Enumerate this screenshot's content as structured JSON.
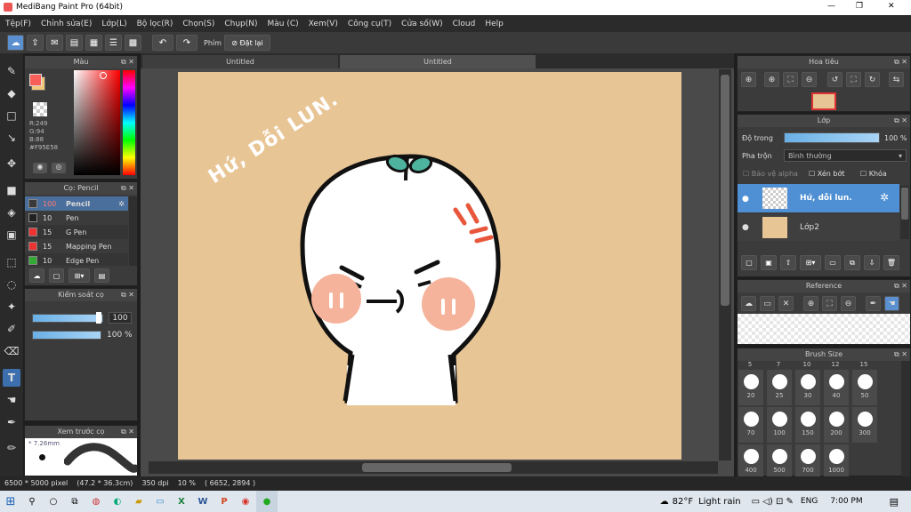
{
  "window": {
    "title": "MediBang Paint Pro (64bit)",
    "minimize": "—",
    "maximize": "❐",
    "close": "✕"
  },
  "menu": [
    "Tệp(F)",
    "Chỉnh sửa(E)",
    "Lớp(L)",
    "Bộ lọc(R)",
    "Chọn(S)",
    "Chụp(N)",
    "Màu (C)",
    "Xem(V)",
    "Công cụ(T)",
    "Cửa số(W)",
    "Cloud",
    "Help"
  ],
  "toolbar": {
    "phim_label": "Phím",
    "reset_label": "Đặt lại"
  },
  "tabs": [
    "Untitled",
    "Untitled"
  ],
  "color_panel": {
    "title": "Màu",
    "r": "R:249",
    "g": "G:94",
    "b": "B:88",
    "hex": "#F95E58",
    "fg": "#F95E58",
    "bg": "#F2C77A"
  },
  "brush_panel": {
    "title": "Cọ: Pencil",
    "items": [
      {
        "size": "100",
        "name": "Pencil",
        "color": "#3a3a3a",
        "selected": true
      },
      {
        "size": "10",
        "name": "Pen",
        "color": "#222"
      },
      {
        "size": "15",
        "name": "G Pen",
        "color": "#e33"
      },
      {
        "size": "15",
        "name": "Mapping Pen",
        "color": "#e33"
      },
      {
        "size": "10",
        "name": "Edge Pen",
        "color": "#3a3"
      }
    ]
  },
  "control_panel": {
    "title": "Kiểm soát cọ",
    "size": "100",
    "opacity": "100 %"
  },
  "preview_panel": {
    "title": "Xem trước cọ",
    "size": "7.26mm"
  },
  "navigator": {
    "title": "Hoa tiêu"
  },
  "layer_panel": {
    "title": "Lớp",
    "opacity_label": "Độ trong",
    "opacity_value": "100 %",
    "blend_label": "Pha trộn",
    "blend_value": "Bình thường",
    "protect_alpha": "Bảo vệ alpha",
    "clip": "Xén bớt",
    "lock": "Khóa",
    "layers": [
      {
        "name": "Hứ, dỗi lun.",
        "selected": true
      },
      {
        "name": "Lớp2",
        "selected": false
      }
    ]
  },
  "reference": {
    "title": "Reference"
  },
  "brush_size": {
    "title": "Brush Size",
    "row0": [
      "5",
      "7",
      "10",
      "12",
      "15"
    ],
    "labels": [
      "20",
      "25",
      "30",
      "40",
      "50",
      "70",
      "100",
      "150",
      "200",
      "300",
      "400",
      "500",
      "700",
      "1000"
    ]
  },
  "canvas": {
    "text": "Hứ, Dỗi LUN."
  },
  "status": {
    "dims": "6500 * 5000 pixel",
    "cm": "(47.2 * 36.3cm)",
    "dpi": "350 dpi",
    "zoom": "10 %",
    "coords": "( 6652, 2894 )"
  },
  "taskbar": {
    "temp": "82°F",
    "weather": "Light rain",
    "lang": "ENG",
    "time": "7:00 PM"
  }
}
